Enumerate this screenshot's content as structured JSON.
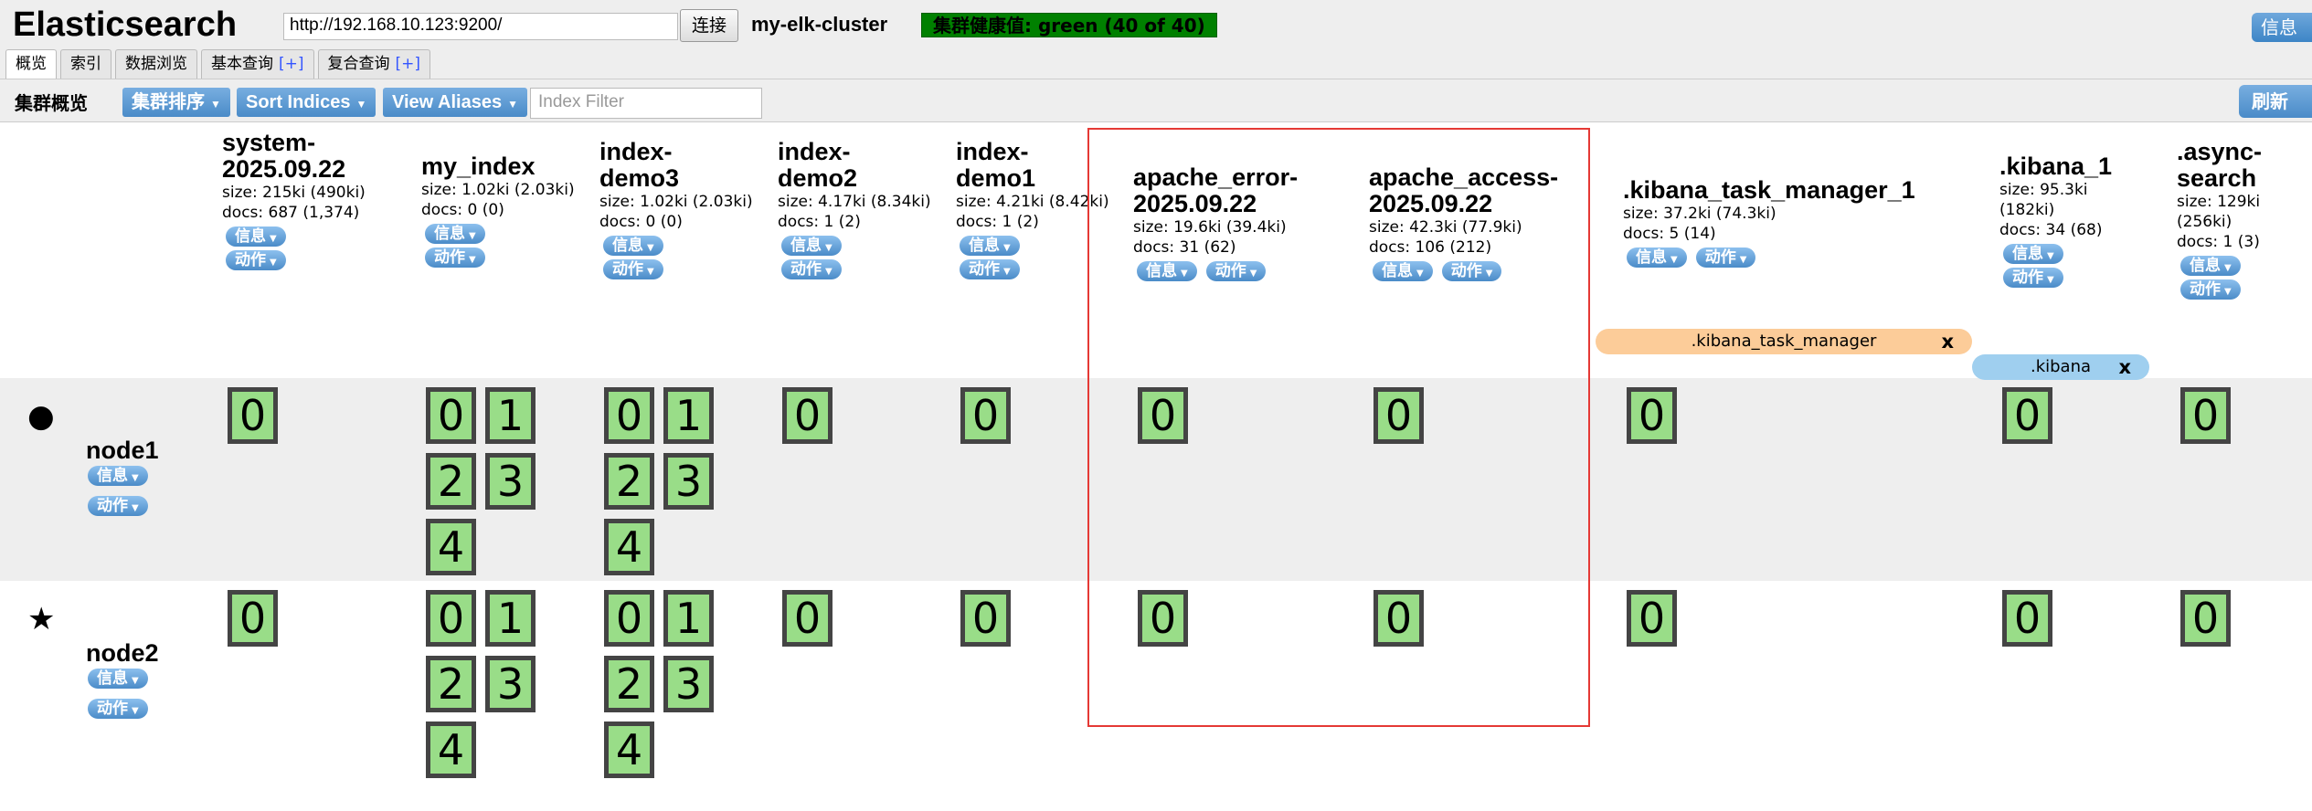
{
  "header": {
    "brand": "Elasticsearch",
    "url": "http://192.168.10.123:9200/",
    "connect_label": "连接",
    "cluster_name": "my-elk-cluster",
    "health": "集群健康值: green (40 of 40)",
    "info_label": "信息"
  },
  "tabs": [
    {
      "label": "概览",
      "plus": ""
    },
    {
      "label": "索引",
      "plus": ""
    },
    {
      "label": "数据浏览",
      "plus": ""
    },
    {
      "label": "基本查询",
      "plus": "[+]"
    },
    {
      "label": "复合查询",
      "plus": "[+]"
    }
  ],
  "toolbar": {
    "title": "集群概览",
    "cluster_sort": "集群排序",
    "sort_indices": "Sort Indices",
    "view_aliases": "View Aliases",
    "index_filter_placeholder": "Index Filter",
    "refresh": "刷新"
  },
  "labels": {
    "info": "信息",
    "action": "动作"
  },
  "indices": [
    {
      "name": "system-2025.09.22",
      "size": "size: 215ki (490ki)",
      "docs": "docs: 687 (1,374)"
    },
    {
      "name": "my_index",
      "size": "size: 1.02ki (2.03ki)",
      "docs": "docs: 0 (0)"
    },
    {
      "name": "index-demo3",
      "size": "size: 1.02ki (2.03ki)",
      "docs": "docs: 0 (0)"
    },
    {
      "name": "index-demo2",
      "size": "size: 4.17ki (8.34ki)",
      "docs": "docs: 1 (2)"
    },
    {
      "name": "index-demo1",
      "size": "size: 4.21ki (8.42ki)",
      "docs": "docs: 1 (2)"
    },
    {
      "name": "apache_error-2025.09.22",
      "size": "size: 19.6ki (39.4ki)",
      "docs": "docs: 31 (62)"
    },
    {
      "name": "apache_access-2025.09.22",
      "size": "size: 42.3ki (77.9ki)",
      "docs": "docs: 106 (212)"
    },
    {
      "name": ".kibana_task_manager_1",
      "size": "size: 37.2ki (74.3ki)",
      "docs": "docs: 5 (14)"
    },
    {
      "name": ".kibana_1",
      "size": "size: 95.3ki (182ki)",
      "docs": "docs: 34 (68)"
    },
    {
      "name": ".async-search",
      "size": "size: 129ki (256ki)",
      "docs": "docs: 1 (3)"
    }
  ],
  "aliases": [
    {
      "name": ".kibana_task_manager",
      "close": "x",
      "color": "#fccc99"
    },
    {
      "name": ".kibana",
      "close": "x",
      "color": "#9fcfef"
    }
  ],
  "nodes": [
    {
      "name": "node1",
      "icon": "circle-icon",
      "glyph": "●"
    },
    {
      "name": "node2",
      "icon": "star-icon",
      "glyph": "★"
    }
  ],
  "shard_labels": [
    "0",
    "1",
    "2",
    "3",
    "4"
  ],
  "colors": {
    "health_green": "#008000",
    "shard_green": "#99dd88",
    "accent_blue": "#4a8bc8",
    "highlight_red": "#e53935"
  }
}
